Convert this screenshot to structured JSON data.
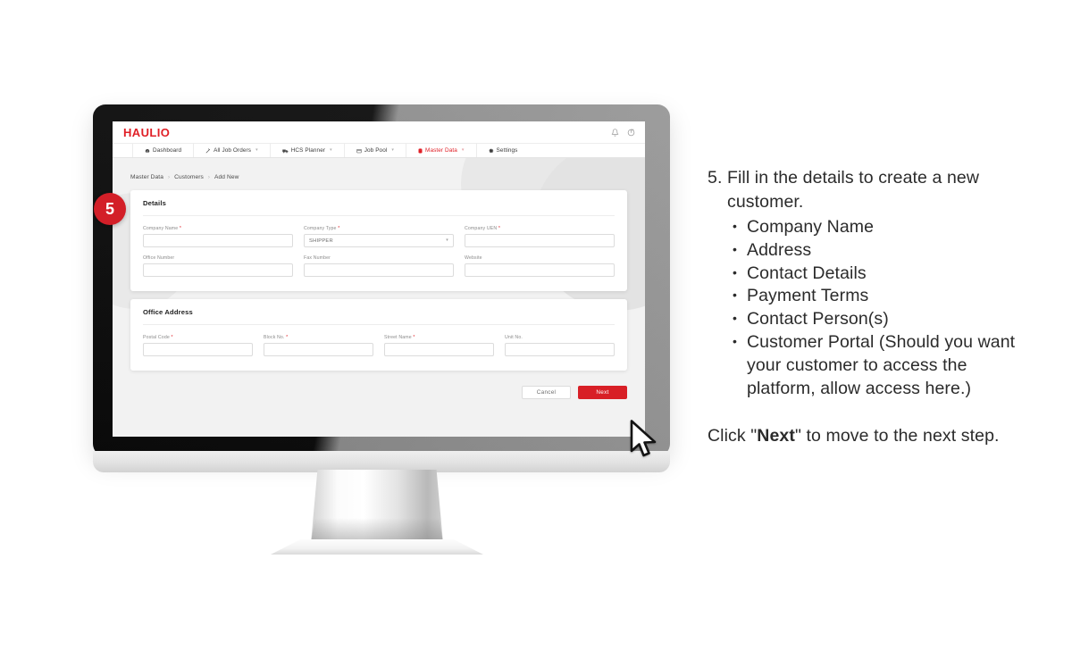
{
  "app": {
    "brand": "HAULIO",
    "header_icons": [
      {
        "name": "notification-bell-icon",
        "label": "Notifications"
      },
      {
        "name": "logout-icon",
        "label": "Logout"
      }
    ],
    "nav": [
      {
        "label": "Dashboard",
        "icon": "speedometer-icon",
        "caret": false,
        "active": false
      },
      {
        "label": "All Job Orders",
        "icon": "pencil-icon",
        "caret": true,
        "active": false
      },
      {
        "label": "HCS Planner",
        "icon": "truck-icon",
        "caret": true,
        "active": false
      },
      {
        "label": "Job Pool",
        "icon": "container-icon",
        "caret": true,
        "active": false
      },
      {
        "label": "Master Data",
        "icon": "database-icon",
        "caret": true,
        "active": true
      },
      {
        "label": "Settings",
        "icon": "gear-icon",
        "caret": false,
        "active": false
      }
    ],
    "breadcrumb": [
      "Master Data",
      "Customers",
      "Add New"
    ],
    "breadcrumb_separator": "›",
    "cards": [
      {
        "title": "Details",
        "rows": [
          [
            {
              "label": "Company Name",
              "required": true,
              "value": "",
              "type": "text",
              "name": "company-name"
            },
            {
              "label": "Company Type",
              "required": true,
              "value": "SHIPPER",
              "type": "select",
              "name": "company-type"
            },
            {
              "label": "Company UEN",
              "required": true,
              "value": "",
              "type": "text",
              "name": "company-uen"
            }
          ],
          [
            {
              "label": "Office Number",
              "required": false,
              "value": "",
              "type": "text",
              "name": "office-number"
            },
            {
              "label": "Fax Number",
              "required": false,
              "value": "",
              "type": "text",
              "name": "fax-number"
            },
            {
              "label": "Website",
              "required": false,
              "value": "",
              "type": "text",
              "name": "website"
            }
          ]
        ]
      },
      {
        "title": "Office Address",
        "rows": [
          [
            {
              "label": "Postal Code",
              "required": true,
              "value": "",
              "type": "text",
              "name": "postal-code"
            },
            {
              "label": "Block No.",
              "required": true,
              "value": "",
              "type": "text",
              "name": "block-no"
            },
            {
              "label": "Street Name",
              "required": true,
              "value": "",
              "type": "text",
              "name": "street-name"
            },
            {
              "label": "Unit No.",
              "required": false,
              "value": "",
              "type": "text",
              "name": "unit-no"
            }
          ]
        ]
      }
    ],
    "actions": {
      "cancel_label": "Cancel",
      "next_label": "Next"
    }
  },
  "annotation": {
    "step_badge": "5"
  },
  "instructions": {
    "step_text": "5. Fill in the details to create a new customer.",
    "bullets": [
      "Company Name",
      "Address",
      "Contact Details",
      "Payment Terms",
      "Contact Person(s)",
      "Customer Portal (Should you want your customer to access the platform, allow access here.)"
    ],
    "closing_prefix": "Click \"",
    "closing_bold": "Next",
    "closing_suffix": "\" to move to the next step."
  },
  "colors": {
    "brand_red": "#e01f26",
    "button_red": "#d81f26",
    "badge_red": "#d31f28",
    "text_dark": "#2b2b2b",
    "label_gray": "#8b8b8b"
  }
}
